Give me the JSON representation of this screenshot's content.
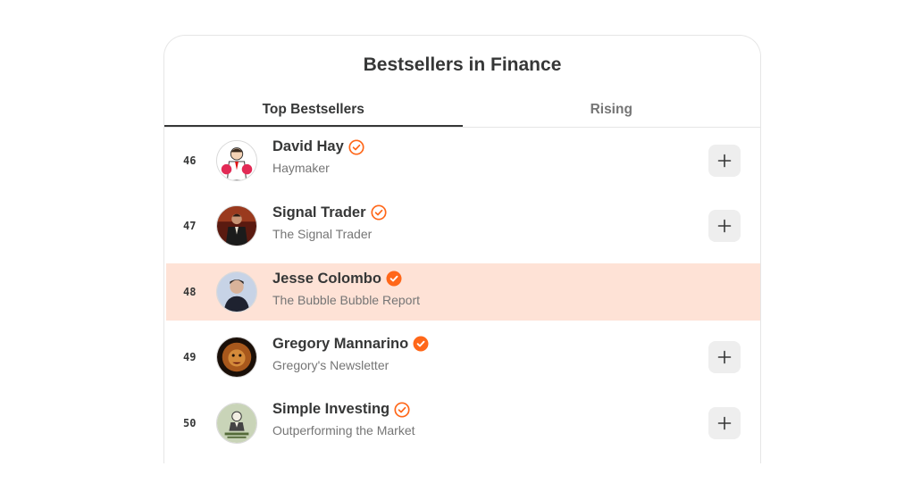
{
  "title": "Bestsellers in Finance",
  "tabs": [
    {
      "label": "Top Bestsellers",
      "active": true
    },
    {
      "label": "Rising",
      "active": false
    }
  ],
  "accent_color": "#ff6719",
  "highlight_color": "#fee2d6",
  "rows": [
    {
      "rank": "46",
      "name": "David Hay",
      "publication": "Haymaker",
      "badge": "outline",
      "avatar_icon": "boxer-avatar-icon",
      "show_add": true
    },
    {
      "rank": "47",
      "name": "Signal Trader",
      "publication": "The Signal Trader",
      "badge": "outline",
      "avatar_icon": "suited-man-avatar-icon",
      "show_add": true
    },
    {
      "rank": "48",
      "name": "Jesse Colombo",
      "publication": "The Bubble Bubble Report",
      "badge": "filled",
      "avatar_icon": "portrait-avatar-icon",
      "show_add": false,
      "highlighted": true
    },
    {
      "rank": "49",
      "name": "Gregory Mannarino",
      "publication": "Gregory's Newsletter",
      "badge": "filled",
      "avatar_icon": "lion-avatar-icon",
      "show_add": true
    },
    {
      "rank": "50",
      "name": "Simple Investing",
      "publication": "Outperforming the Market",
      "badge": "outline",
      "avatar_icon": "sketch-avatar-icon",
      "show_add": true
    }
  ]
}
